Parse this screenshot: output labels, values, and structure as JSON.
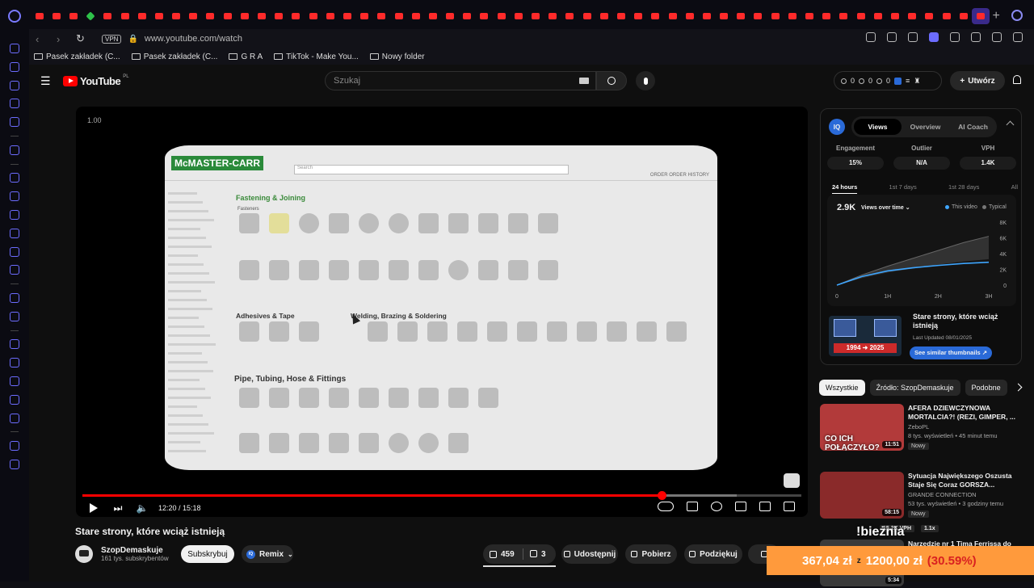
{
  "browser": {
    "tabs_count": 56,
    "address": "www.youtube.com/watch",
    "vpn_label": "VPN",
    "bookmarks": [
      {
        "label": "Pasek zakładek (C..."
      },
      {
        "label": "Pasek zakładek (C..."
      },
      {
        "label": "G R A"
      },
      {
        "label": "TikTok - Make You..."
      },
      {
        "label": "Nowy folder"
      }
    ]
  },
  "youtube": {
    "logo_text": "YouTube",
    "country_code": "PL",
    "search_placeholder": "Szukaj",
    "header_stats": [
      "0",
      "0",
      "0"
    ],
    "create_label": "Utwórz"
  },
  "player": {
    "version_label": "1.00",
    "time_current": "12:20",
    "time_total": "15:18",
    "time_display": "12:20 / 15:18",
    "progress_fraction": 0.806,
    "buffer_fraction": 0.91,
    "screen": {
      "logo": "McMASTER-CARR",
      "search_placeholder": "Search",
      "order_labels": "ORDER   ORDER HISTORY",
      "section_fastening": "Fastening & Joining",
      "sub_fasteners": "Fasteners",
      "section_adhesives": "Adhesives & Tape",
      "section_welding": "Welding, Brazing & Soldering",
      "section_pipe": "Pipe, Tubing, Hose & Fittings"
    }
  },
  "video": {
    "title": "Stare strony, które wciąż istnieją",
    "channel_name": "SzopDemaskuje",
    "subscribers": "161 tys. subskrybentów",
    "subscribe_label": "Subskrybuj",
    "remix_label": "Remix",
    "likes": "459",
    "dislikes": "3",
    "share_label": "Udostępnij",
    "download_label": "Pobierz",
    "thanks_label": "Podziękuj"
  },
  "vidiq": {
    "logo": "IQ",
    "tabs": [
      "Views",
      "Overview",
      "AI Coach"
    ],
    "metrics": [
      {
        "label": "Engagement",
        "value": "15%"
      },
      {
        "label": "Outlier",
        "value": "N/A"
      },
      {
        "label": "VPH",
        "value": "1.4K"
      }
    ],
    "ranges": [
      "24 hours",
      "1st 7 days",
      "1st 28 days",
      "All"
    ],
    "chart": {
      "current_value": "2.9K",
      "selector": "Views over time",
      "legend_this": "This video",
      "legend_typical": "Typical"
    },
    "thumb": {
      "left_date": "1994",
      "right_date": "2025",
      "title": "Stare strony, które wciąż istnieją",
      "updated": "Last Updated 08/01/2025",
      "button": "See similar thumbnails"
    }
  },
  "chart_data": {
    "type": "area",
    "title": "",
    "xlabel": "",
    "ylabel": "",
    "x_ticks": [
      "0",
      "1H",
      "2H",
      "3H"
    ],
    "y_ticks": [
      "0",
      "2K",
      "4K",
      "6K",
      "8K"
    ],
    "x": [
      0,
      0.5,
      1,
      1.5,
      2,
      2.5,
      3
    ],
    "series": [
      {
        "name": "This video",
        "values": [
          0,
          1.1,
          1.8,
          2.2,
          2.5,
          2.75,
          2.9
        ]
      },
      {
        "name": "Typical",
        "values": [
          0,
          1.3,
          2.4,
          3.4,
          4.4,
          5.4,
          6.2
        ]
      }
    ],
    "typical_band_low": [
      0,
      0.9,
      1.6,
      2.1,
      2.6,
      3.0,
      3.3
    ],
    "ylim": [
      0,
      8
    ],
    "xlim": [
      0,
      3
    ]
  },
  "chips": [
    "Wszystkie",
    "Źródło: SzopDemaskuje",
    "Podobne"
  ],
  "recommendations": [
    {
      "title": "AFERA DZIEWCZYNOWA MORTALCIA?! (REZI, GIMPER, ...",
      "channel": "ZeboPL",
      "meta": "8 tys. wyświetleń • 45 minut temu",
      "badge": "Nowy",
      "duration": "11:51",
      "thumb_text": "CO ICH POŁĄCZYŁO?",
      "thumb_color": "#b23a3a"
    },
    {
      "title": "Sytuacja Największego Oszusta Staje Się Coraz GORSZA...",
      "channel": "GRANDE CONNECTION",
      "meta": "53 tys. wyświetleń • 3 godziny temu",
      "badge": "Nowy",
      "duration": "58:15",
      "thumb_text": "",
      "thumb_color": "#8a2a2a",
      "vph": "15.2K VPH",
      "vph_mult": "1.1x"
    },
    {
      "title": "Narzędzie nr 1 Tima Ferrissa do podejmowania odważnych ...",
      "channel": "",
      "meta": "",
      "badge": "",
      "duration": "5:34",
      "thumb_text": "",
      "thumb_color": "#3a3a3a"
    }
  ],
  "overlay": {
    "tag": "!bieżnia",
    "current": "367,04 zł",
    "separator": "z",
    "goal": "1200,00 zł",
    "percent": "(30.59%)"
  }
}
